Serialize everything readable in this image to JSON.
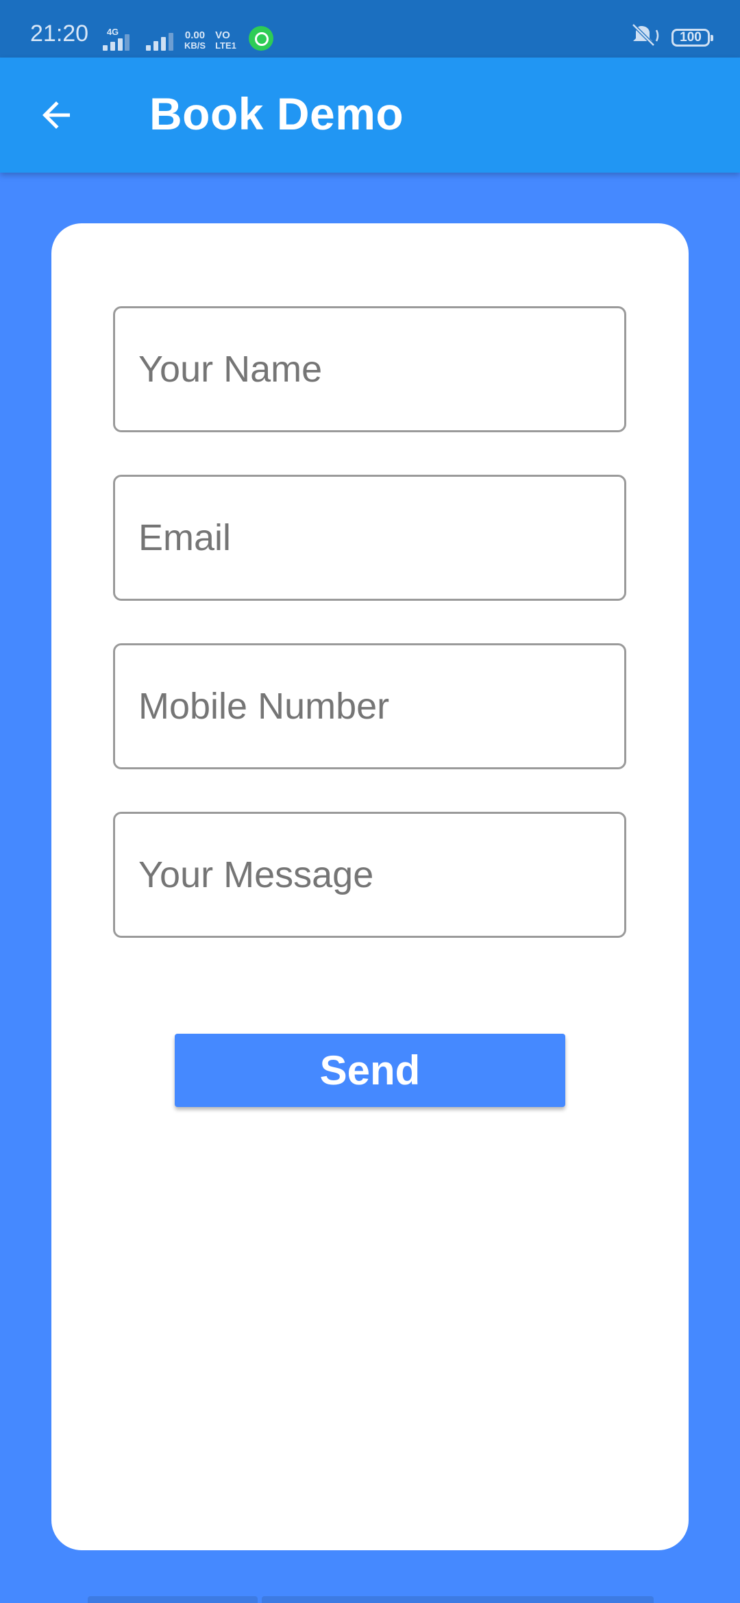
{
  "status_bar": {
    "time": "21:20",
    "network_label": "4G",
    "speed_value": "0.00",
    "speed_unit": "KB/S",
    "volte_top": "VO",
    "volte_bottom": "LTE1",
    "battery": "100",
    "icons": [
      "signal-4g-icon",
      "signal-icon",
      "whatsapp-icon",
      "vibrate-mute-icon",
      "battery-icon"
    ]
  },
  "app_bar": {
    "title": "Book Demo",
    "back_icon": "arrow-left-icon",
    "color": "#2196F3"
  },
  "form": {
    "name_placeholder": "Your Name",
    "email_placeholder": "Email",
    "mobile_placeholder": "Mobile Number",
    "message_placeholder": "Your Message",
    "send_label": "Send"
  },
  "colors": {
    "background": "#4589FF",
    "status_bar": "#1B6FC0",
    "button": "#4589FF",
    "card": "#FFFFFF"
  }
}
